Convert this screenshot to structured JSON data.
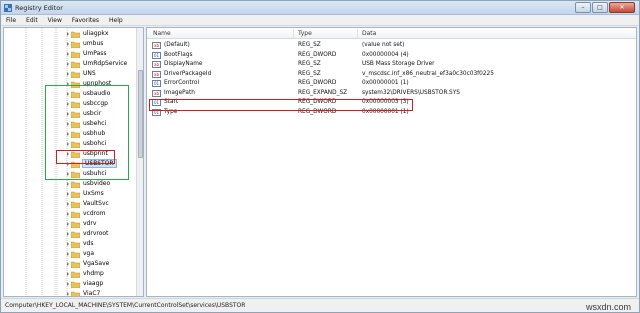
{
  "window": {
    "title": "Registry Editor"
  },
  "menu": [
    "File",
    "Edit",
    "View",
    "Favorites",
    "Help"
  ],
  "tree": {
    "items": [
      {
        "label": "uliagpkx"
      },
      {
        "label": "umbus"
      },
      {
        "label": "UmPass"
      },
      {
        "label": "UmRdpService"
      },
      {
        "label": "UNS"
      },
      {
        "label": "upnphost"
      },
      {
        "label": "usbaudio"
      },
      {
        "label": "usbccgp"
      },
      {
        "label": "usbcir"
      },
      {
        "label": "usbehci"
      },
      {
        "label": "usbhub"
      },
      {
        "label": "usbohci"
      },
      {
        "label": "usbprint"
      },
      {
        "label": "USBSTOR",
        "selected": true
      },
      {
        "label": "usbuhci"
      },
      {
        "label": "usbvideo"
      },
      {
        "label": "UxSms"
      },
      {
        "label": "VaultSvc"
      },
      {
        "label": "vcdrom"
      },
      {
        "label": "vdrv"
      },
      {
        "label": "vdrvroot"
      },
      {
        "label": "vds"
      },
      {
        "label": "vga"
      },
      {
        "label": "VgaSave"
      },
      {
        "label": "vhdmp"
      },
      {
        "label": "viaagp"
      },
      {
        "label": "ViaC7"
      }
    ]
  },
  "list": {
    "columns": [
      "Name",
      "Type",
      "Data"
    ],
    "rows": [
      {
        "name": "(Default)",
        "type": "REG_SZ",
        "data": "(value not set)",
        "kind": "sz"
      },
      {
        "name": "BootFlags",
        "type": "REG_DWORD",
        "data": "0x00000004 (4)",
        "kind": "dword"
      },
      {
        "name": "DisplayName",
        "type": "REG_SZ",
        "data": "USB Mass Storage Driver",
        "kind": "sz"
      },
      {
        "name": "DriverPackageId",
        "type": "REG_SZ",
        "data": "v_mscdsc.inf_x86_neutral_ef3a0c30c03f0225",
        "kind": "sz"
      },
      {
        "name": "ErrorControl",
        "type": "REG_DWORD",
        "data": "0x00000001 (1)",
        "kind": "dword"
      },
      {
        "name": "ImagePath",
        "type": "REG_EXPAND_SZ",
        "data": "system32\\DRIVERS\\USBSTOR.SYS",
        "kind": "sz"
      },
      {
        "name": "Start",
        "type": "REG_DWORD",
        "data": "0x00000003 (3)",
        "kind": "dword"
      },
      {
        "name": "Type",
        "type": "REG_DWORD",
        "data": "0x00000001 (1)",
        "kind": "dword"
      }
    ]
  },
  "status": {
    "path": "Computer\\HKEY_LOCAL_MACHINE\\SYSTEM\\CurrentControlSet\\services\\USBSTOR"
  },
  "watermark": "wsxdn.com",
  "colors": {
    "highlight_green": "#2aa84a",
    "highlight_red": "#d01e1e",
    "selection": "#cde6f7"
  }
}
